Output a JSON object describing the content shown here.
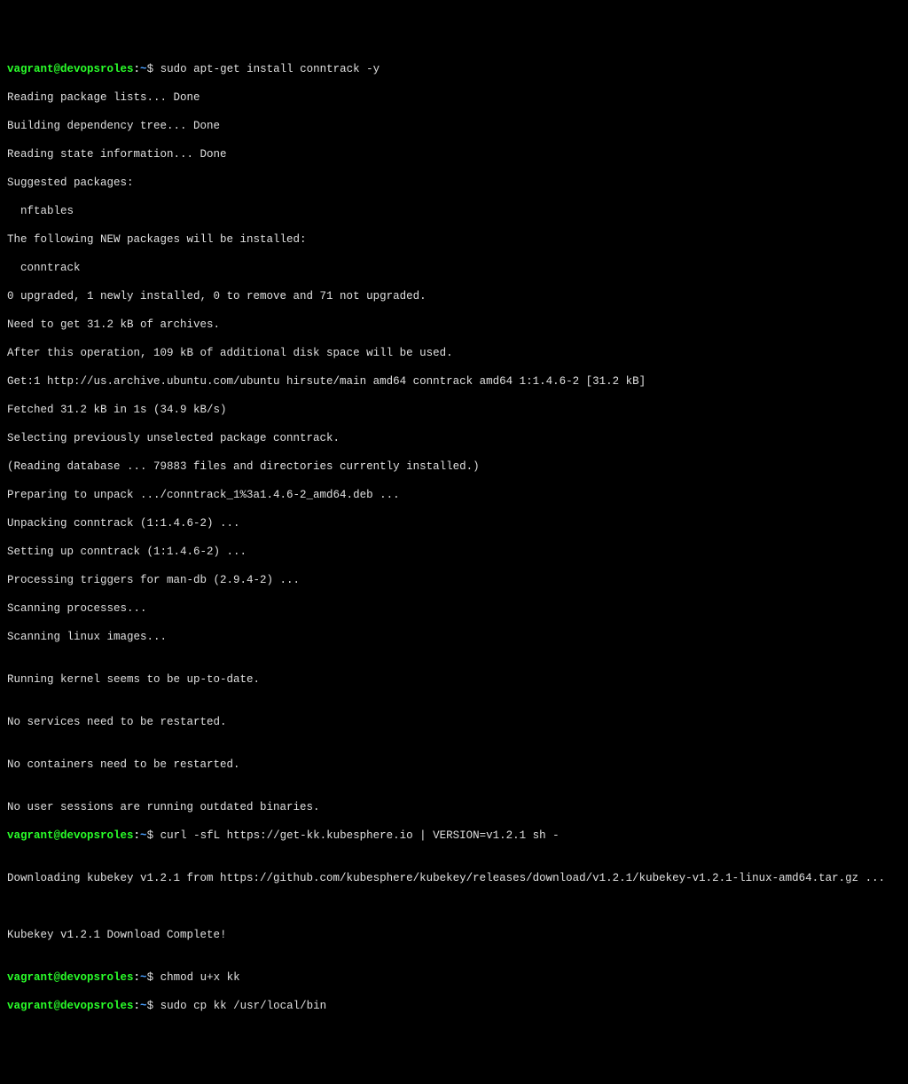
{
  "prompt": {
    "user_host": "vagrant@devopsroles",
    "colon": ":",
    "cwd": "~",
    "dollar": "$ "
  },
  "commands": {
    "c1": "sudo apt-get install conntrack -y",
    "c2": "curl -sfL https://get-kk.kubesphere.io | VERSION=v1.2.1 sh -",
    "c3": "chmod u+x kk",
    "c4": "sudo cp kk /usr/local/bin"
  },
  "output": {
    "l01": "Reading package lists... Done",
    "l02": "Building dependency tree... Done",
    "l03": "Reading state information... Done",
    "l04": "Suggested packages:",
    "l05": "  nftables",
    "l06": "The following NEW packages will be installed:",
    "l07": "  conntrack",
    "l08": "0 upgraded, 1 newly installed, 0 to remove and 71 not upgraded.",
    "l09": "Need to get 31.2 kB of archives.",
    "l10": "After this operation, 109 kB of additional disk space will be used.",
    "l11": "Get:1 http://us.archive.ubuntu.com/ubuntu hirsute/main amd64 conntrack amd64 1:1.4.6-2 [31.2 kB]",
    "l12": "Fetched 31.2 kB in 1s (34.9 kB/s)",
    "l13": "Selecting previously unselected package conntrack.",
    "l14": "(Reading database ... 79883 files and directories currently installed.)",
    "l15": "Preparing to unpack .../conntrack_1%3a1.4.6-2_amd64.deb ...",
    "l16": "Unpacking conntrack (1:1.4.6-2) ...",
    "l17": "Setting up conntrack (1:1.4.6-2) ...",
    "l18": "Processing triggers for man-db (2.9.4-2) ...",
    "l19": "Scanning processes...",
    "l20": "Scanning linux images...",
    "l21": "",
    "l22": "Running kernel seems to be up-to-date.",
    "l23": "",
    "l24": "No services need to be restarted.",
    "l25": "",
    "l26": "No containers need to be restarted.",
    "l27": "",
    "l28": "No user sessions are running outdated binaries.",
    "l29": "",
    "l30": "Downloading kubekey v1.2.1 from https://github.com/kubesphere/kubekey/releases/download/v1.2.1/kubekey-v1.2.1-linux-amd64.tar.gz ...",
    "l31": "",
    "l32": "",
    "l33": "Kubekey v1.2.1 Download Complete!",
    "l34": ""
  }
}
